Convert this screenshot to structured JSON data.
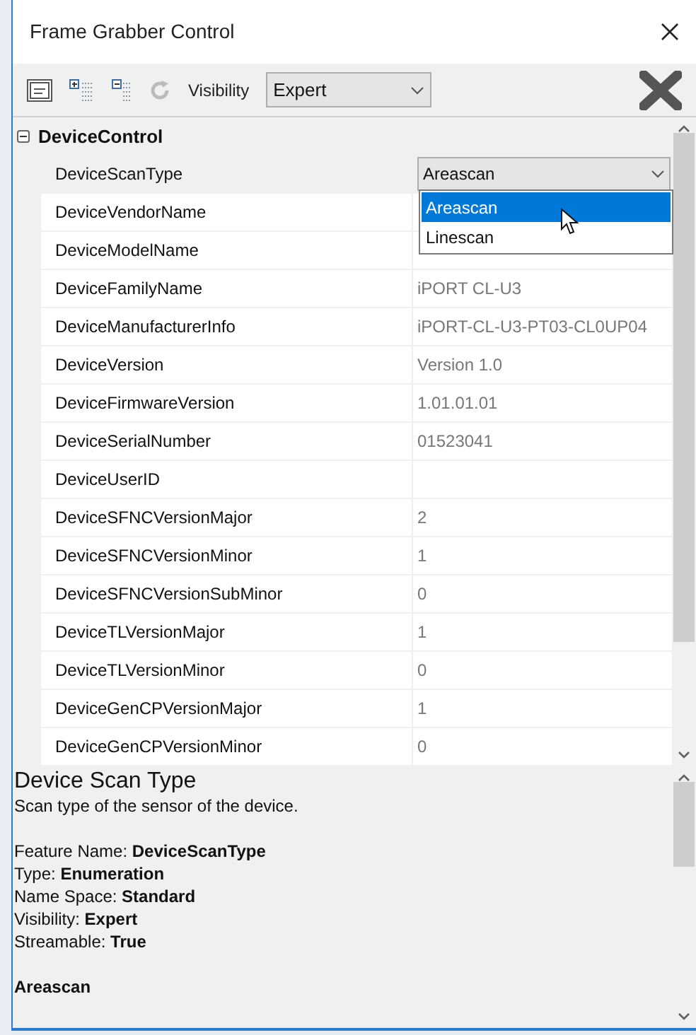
{
  "window": {
    "title": "Frame Grabber Control"
  },
  "toolbar": {
    "visibility_label": "Visibility",
    "visibility_value": "Expert"
  },
  "category": {
    "name": "DeviceControl",
    "expanded": true
  },
  "rows": [
    {
      "name": "DeviceScanType",
      "value": "Areascan",
      "kind": "combo",
      "selected": true
    },
    {
      "name": "DeviceVendorName",
      "kind": "text",
      "selected": false
    },
    {
      "name": "DeviceModelName",
      "kind": "text",
      "selected": false
    },
    {
      "name": "DeviceFamilyName",
      "value": "iPORT CL-U3",
      "kind": "text",
      "selected": false
    },
    {
      "name": "DeviceManufacturerInfo",
      "value": "iPORT-CL-U3-PT03-CL0UP04",
      "kind": "text",
      "selected": false
    },
    {
      "name": "DeviceVersion",
      "value": "Version 1.0",
      "kind": "text",
      "selected": false
    },
    {
      "name": "DeviceFirmwareVersion",
      "value": "1.01.01.01",
      "kind": "text",
      "selected": false
    },
    {
      "name": "DeviceSerialNumber",
      "value": "01523041",
      "kind": "text",
      "selected": false
    },
    {
      "name": "DeviceUserID",
      "kind": "text",
      "selected": false
    },
    {
      "name": "DeviceSFNCVersionMajor",
      "value": "2",
      "kind": "text",
      "selected": false
    },
    {
      "name": "DeviceSFNCVersionMinor",
      "value": "1",
      "kind": "text",
      "selected": false
    },
    {
      "name": "DeviceSFNCVersionSubMinor",
      "value": "0",
      "kind": "text",
      "selected": false
    },
    {
      "name": "DeviceTLVersionMajor",
      "value": "1",
      "kind": "text",
      "selected": false
    },
    {
      "name": "DeviceTLVersionMinor",
      "value": "0",
      "kind": "text",
      "selected": false
    },
    {
      "name": "DeviceGenCPVersionMajor",
      "value": "1",
      "kind": "text",
      "selected": false
    },
    {
      "name": "DeviceGenCPVersionMinor",
      "value": "0",
      "kind": "text",
      "selected": false
    }
  ],
  "dropdown": {
    "options": [
      {
        "label": "Areascan",
        "selected": true
      },
      {
        "label": "Linescan",
        "selected": false
      }
    ]
  },
  "description": {
    "title": "Device Scan Type",
    "summary": "Scan type of the sensor of the device.",
    "details": [
      "Feature Name: **DeviceScanType**",
      "Type: **Enumeration**",
      "Name Space: **Standard**",
      "Visibility: **Expert**",
      "Streamable: **True**"
    ],
    "current_value": "Areascan"
  }
}
